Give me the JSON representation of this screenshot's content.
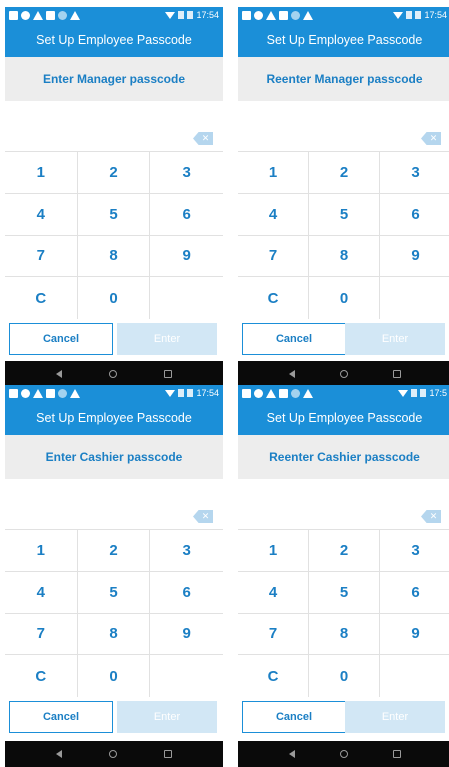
{
  "screens": [
    {
      "status_time": "17:54",
      "title": "Set Up Employee Passcode",
      "prompt": "Enter Manager passcode",
      "keys": [
        "1",
        "2",
        "3",
        "4",
        "5",
        "6",
        "7",
        "8",
        "9",
        "C",
        "0",
        ""
      ],
      "cancel_label": "Cancel",
      "enter_label": "Enter"
    },
    {
      "status_time": "17:54",
      "title": "Set Up Employee Passcode",
      "prompt": "Reenter Manager passcode",
      "keys": [
        "1",
        "2",
        "3",
        "4",
        "5",
        "6",
        "7",
        "8",
        "9",
        "C",
        "0",
        ""
      ],
      "cancel_label": "Cancel",
      "enter_label": "Enter"
    },
    {
      "status_time": "17:54",
      "title": "Set Up Employee Passcode",
      "prompt": "Enter Cashier passcode",
      "keys": [
        "1",
        "2",
        "3",
        "4",
        "5",
        "6",
        "7",
        "8",
        "9",
        "C",
        "0",
        ""
      ],
      "cancel_label": "Cancel",
      "enter_label": "Enter"
    },
    {
      "status_time": "17:5",
      "title": "Set Up Employee Passcode",
      "prompt": "Reenter Cashier passcode",
      "keys": [
        "1",
        "2",
        "3",
        "4",
        "5",
        "6",
        "7",
        "8",
        "9",
        "C",
        "0",
        ""
      ],
      "cancel_label": "Cancel",
      "enter_label": "Enter"
    }
  ],
  "colors": {
    "brand_blue": "#1b8fd8",
    "prompt_text": "#1b7fc4",
    "prompt_bg": "#ededed",
    "enter_disabled": "#d2e7f5",
    "nav_bg": "#0a0a0a"
  },
  "icons": {
    "status_left": [
      "sim-icon",
      "info-icon",
      "warning-icon",
      "square-icon",
      "record-icon",
      "warning-icon"
    ],
    "status_right": [
      "wifi-icon",
      "signal-icon",
      "battery-icon"
    ],
    "backspace": "backspace-icon",
    "nav": [
      "back-icon",
      "home-icon",
      "recents-icon"
    ]
  }
}
